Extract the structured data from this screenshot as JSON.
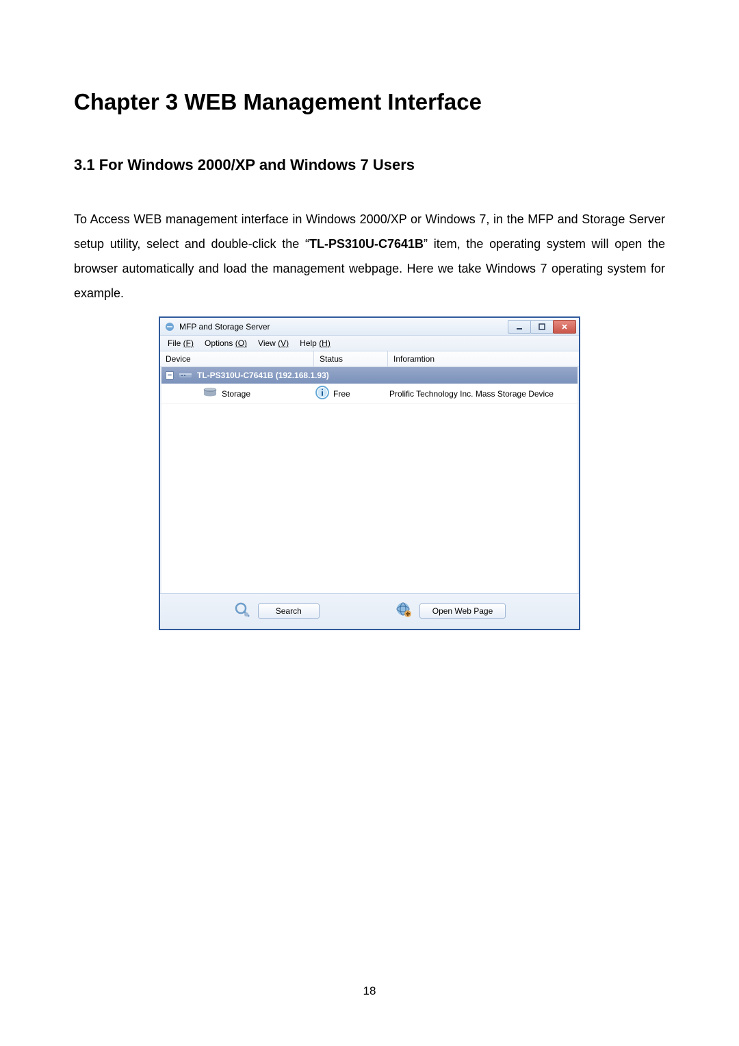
{
  "heading": "Chapter 3   WEB Management Interface",
  "subheading": "3.1   For Windows 2000/XP and Windows 7 Users",
  "paragraph_pre": "To Access WEB management interface in Windows 2000/XP or Windows 7, in the MFP and Storage Server setup utility, select and double-click the “",
  "paragraph_bold": "TL-PS310U-C7641B",
  "paragraph_post": "” item, the operating system will open the browser automatically and load the management webpage. Here we take Windows 7 operating system for example.",
  "page_number": "18",
  "window": {
    "title": "MFP and Storage Server",
    "menus": {
      "file": {
        "label": "File ",
        "accel": "(F)"
      },
      "options": {
        "label": "Options ",
        "accel": "(O)"
      },
      "view": {
        "label": "View ",
        "accel": "(V)"
      },
      "help": {
        "label": "Help ",
        "accel": "(H)"
      }
    },
    "columns": {
      "device": "Device",
      "status": "Status",
      "information": "Inforamtion"
    },
    "group": {
      "expand_glyph": "−",
      "label": "TL-PS310U-C7641B (192.168.1.93)"
    },
    "child": {
      "device": "Storage",
      "status": "Free",
      "info": "Prolific Technology Inc. Mass Storage Device"
    },
    "buttons": {
      "search": "Search",
      "open_web_page": "Open Web Page"
    }
  }
}
